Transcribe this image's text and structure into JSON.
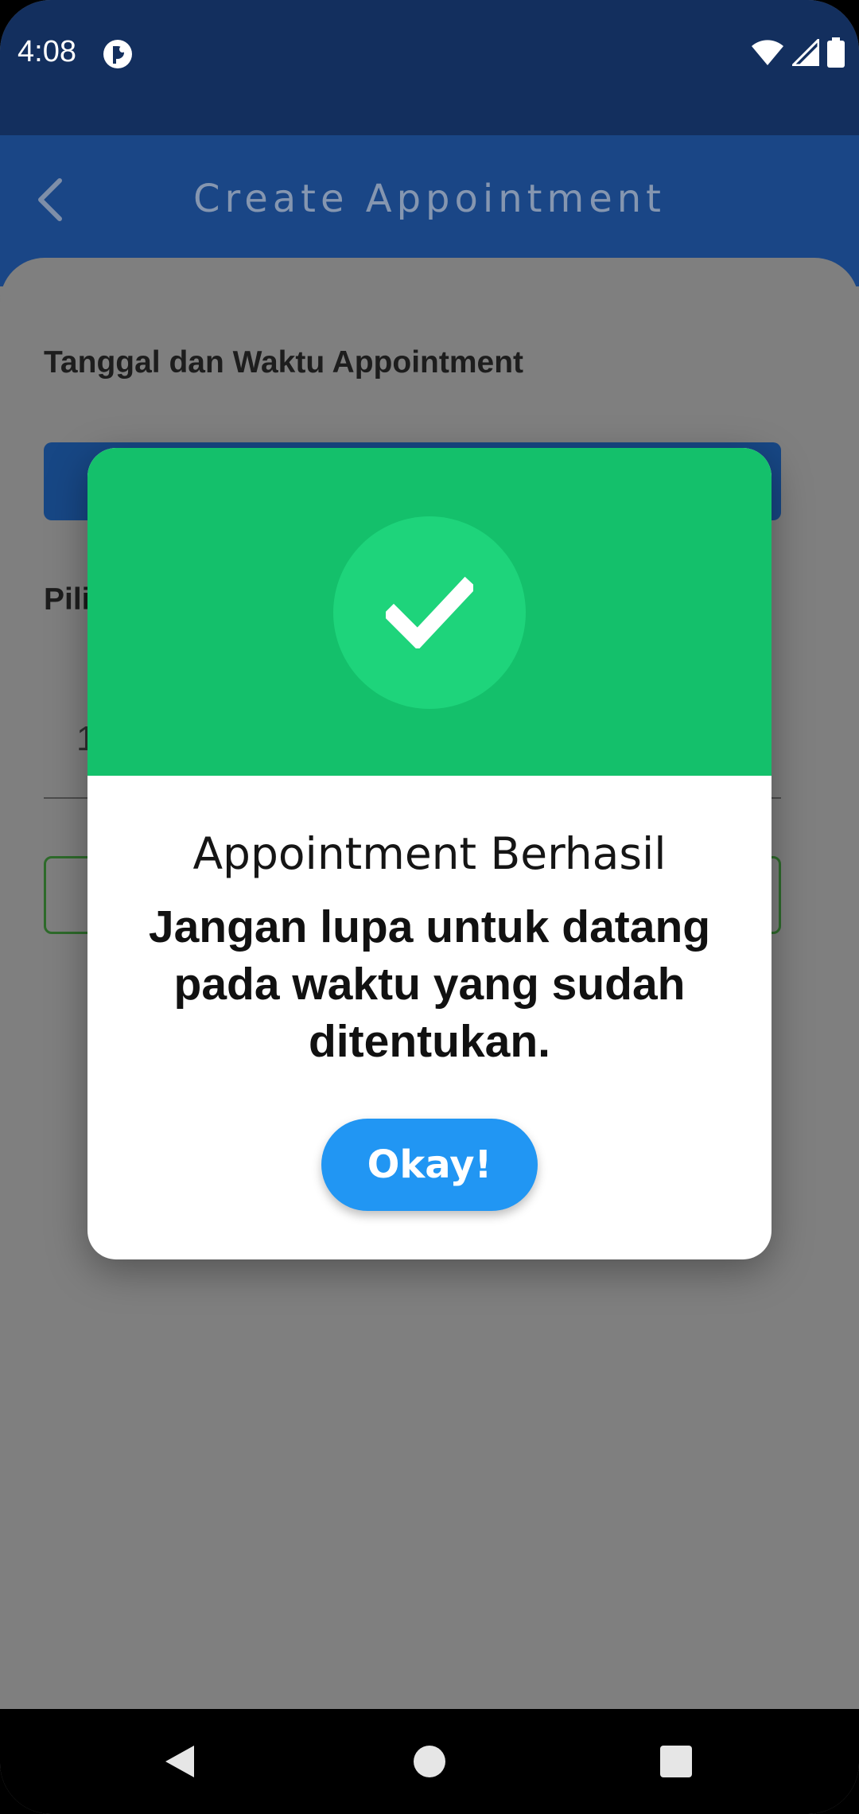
{
  "status_bar": {
    "time": "4:08",
    "app_icon": "notification-app-icon",
    "icons": [
      "wifi-icon",
      "signal-icon",
      "battery-icon"
    ]
  },
  "header": {
    "title": "Create Appointment",
    "back_icon": "chevron-left-icon"
  },
  "form": {
    "datetime_label": "Tanggal dan Waktu Appointment",
    "pick_label_partial": "Pili",
    "time_partial": "1"
  },
  "dialog": {
    "icon": "checkmark-icon",
    "title": "Appointment Berhasil",
    "message": "Jangan lupa untuk datang pada waktu yang sudah ditentukan.",
    "button_label": "Okay!"
  },
  "colors": {
    "status_bar": "#132f5e",
    "header": "#1a4686",
    "dialog_top": "#14c06b",
    "check_circle": "#1ed47b",
    "button": "#2196f3"
  },
  "nav_bar": {
    "icons": [
      "back-triangle-icon",
      "home-circle-icon",
      "recents-square-icon"
    ]
  }
}
